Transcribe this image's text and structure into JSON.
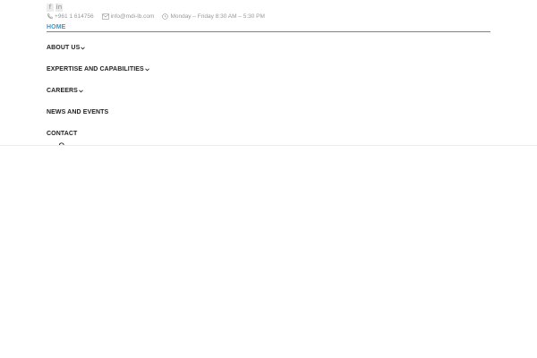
{
  "topbar": {
    "social": [
      {
        "icon": "facebook-icon",
        "glyph": "f"
      },
      {
        "icon": "linkedin-icon",
        "glyph": "in"
      }
    ],
    "phone": "+961 1 614756",
    "email": "info@mdi-lb.com",
    "hours": "Monday – Friday 8:30 AM – 5:30 PM"
  },
  "nav": {
    "home": "HOME",
    "about": "ABOUT US",
    "expertise": "EXPERTISE AND CAPABILITIES",
    "careers": "CAREERS",
    "news": "NEWS AND EVENTS",
    "contact": "CONTACT"
  },
  "colors": {
    "accent": "#2d9cdb",
    "text": "#222222",
    "muted": "#999999"
  }
}
